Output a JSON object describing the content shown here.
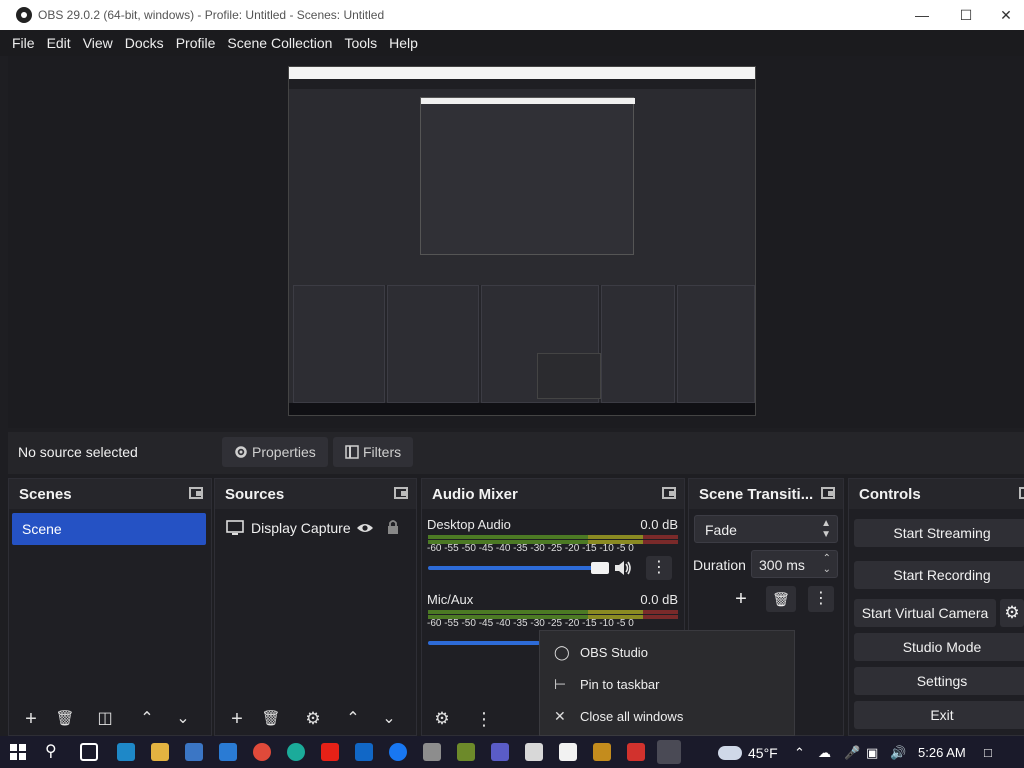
{
  "window": {
    "title": "OBS 29.0.2 (64-bit, windows) - Profile: Untitled - Scenes: Untitled"
  },
  "menu": [
    "File",
    "Edit",
    "View",
    "Docks",
    "Profile",
    "Scene Collection",
    "Tools",
    "Help"
  ],
  "sourcebar": {
    "status": "No source selected",
    "properties": "Properties",
    "filters": "Filters"
  },
  "docks": {
    "scenes": {
      "title": "Scenes",
      "items": [
        "Scene"
      ]
    },
    "sources": {
      "title": "Sources",
      "items": [
        "Display Capture"
      ]
    },
    "audio": {
      "title": "Audio Mixer",
      "channels": [
        {
          "name": "Desktop Audio",
          "db": "0.0 dB",
          "volume": 1.0
        },
        {
          "name": "Mic/Aux",
          "db": "0.0 dB",
          "volume": 1.0
        }
      ],
      "ticks": "-60 -55 -50 -45 -40 -35 -30 -25 -20 -15 -10 -5 0"
    },
    "transitions": {
      "title": "Scene Transiti...",
      "type": "Fade",
      "duration_label": "Duration",
      "duration_value": "300 ms"
    },
    "controls": {
      "title": "Controls",
      "buttons": [
        "Start Streaming",
        "Start Recording",
        "Start Virtual Camera",
        "Studio Mode",
        "Settings",
        "Exit"
      ]
    }
  },
  "context_menu": [
    "OBS Studio",
    "Pin to taskbar",
    "Close all windows"
  ],
  "taskbar": {
    "weather": "45°F",
    "time": "5:26 AM"
  },
  "colors": {
    "accent": "#2552c4",
    "volume": "#2d6bd7",
    "meter_green": "#4c7a24",
    "meter_yellow": "#8a8a22",
    "meter_red": "#7a2a2a"
  }
}
